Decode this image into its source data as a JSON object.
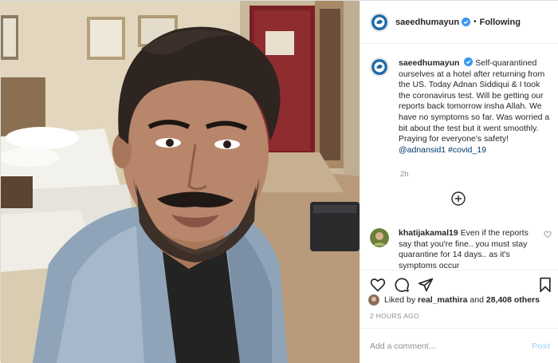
{
  "post": {
    "username": "saeedhumayun",
    "follow_status": "Following",
    "separator": "•",
    "icons": {
      "avatar": "circular-logo-avatar",
      "verified": "verified-badge-icon",
      "load_more": "plus-circle-icon",
      "like": "heart-icon",
      "comment": "comment-icon",
      "share": "paper-plane-icon",
      "save": "bookmark-icon"
    }
  },
  "caption": {
    "username": "saeedhumayun",
    "text": "Self-quarantined ourselves at a hotel after returning from the US. Today Adnan Siddiqui & I took the coronavirus test. Will be getting our reports back tomorrow insha Allah. We have no symptoms so far. Was worried a bit about the test but it went smoothly. Praying for everyone's safety!",
    "mention": "@adnansid1",
    "hashtag": "#covid_19",
    "time": "2h"
  },
  "comments": [
    {
      "username": "khatijakamal19",
      "text": "Even if the reports say that you're fine.. you must stay quarantine for 14 days.. as it's symptoms occur"
    }
  ],
  "likes": {
    "prefix": "Liked by",
    "user": "real_mathira",
    "and": "and",
    "count": "28,408 others"
  },
  "timestamp": "2 HOURS AGO",
  "add_comment": {
    "placeholder": "Add a comment...",
    "post_label": "Post"
  },
  "colors": {
    "link": "#00376b",
    "verified": "#3897f0",
    "muted": "#8e8e8e",
    "post_disabled": "#b2dffc"
  }
}
